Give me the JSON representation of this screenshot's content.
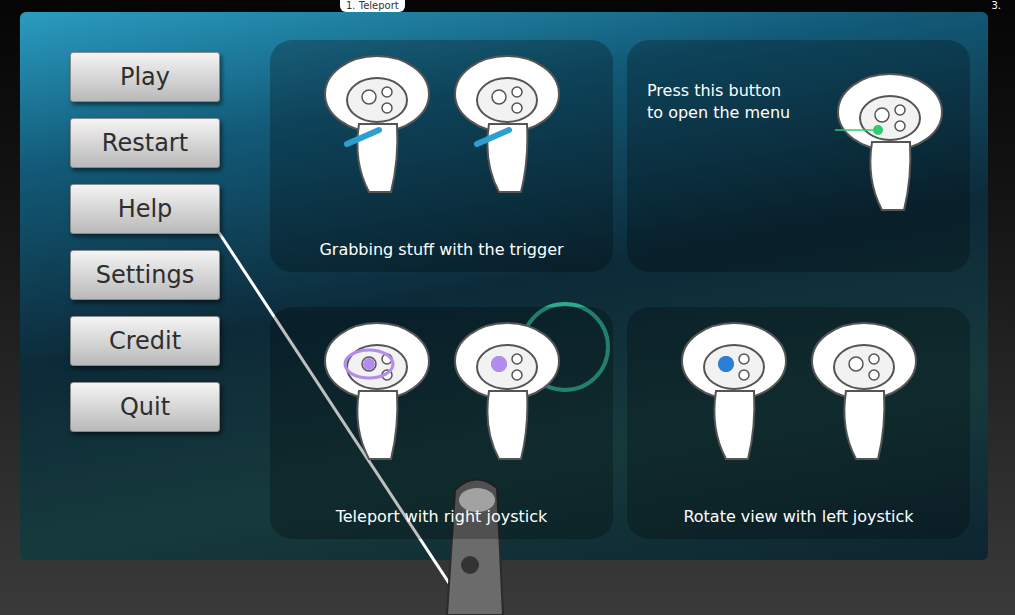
{
  "top_labels": [
    "1. Teleport",
    "3."
  ],
  "menu": {
    "buttons": [
      "Play",
      "Restart",
      "Help",
      "Settings",
      "Credit",
      "Quit"
    ]
  },
  "help_cards": [
    {
      "kind": "grab",
      "caption": "Grabbing stuff with the trigger"
    },
    {
      "kind": "menu",
      "caption": "Press this button to open the menu"
    },
    {
      "kind": "teleport",
      "caption": "Teleport with right joystick"
    },
    {
      "kind": "rotate",
      "caption": "Rotate view with left joystick"
    }
  ]
}
